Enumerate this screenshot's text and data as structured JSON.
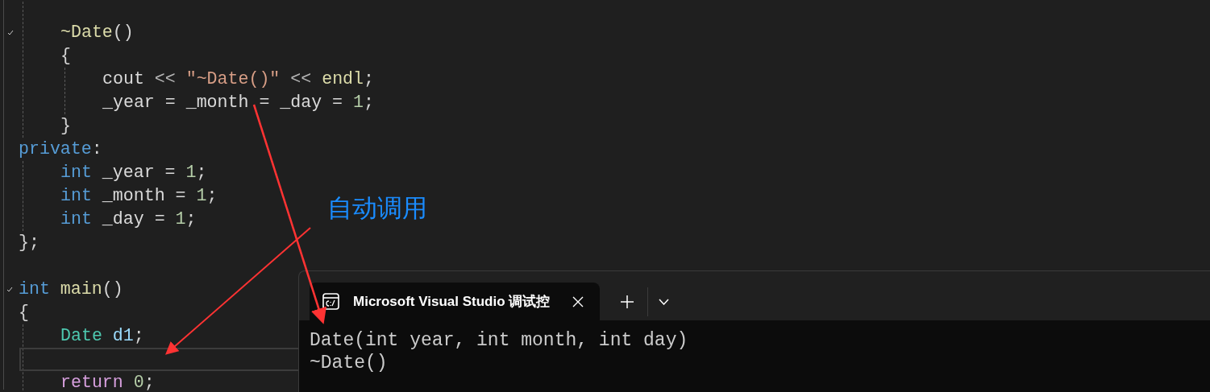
{
  "editor": {
    "lines": [
      {
        "children": [
          {
            "kind": "blank"
          },
          {
            "kind": "code",
            "expanded": true,
            "tokens": [
              {
                "text": "~Date",
                "kind": "function"
              },
              {
                "text": "()",
                "kind": "plain"
              }
            ]
          },
          {
            "kind": "code",
            "tokens": [
              {
                "text": "{",
                "kind": "plain"
              }
            ],
            "children": [
              {
                "kind": "code",
                "tokens": [
                  {
                    "text": "cout",
                    "kind": "variable"
                  },
                  {
                    "text": " << ",
                    "kind": "operator"
                  },
                  {
                    "text": "\"~Date()\"",
                    "kind": "string"
                  },
                  {
                    "text": " << ",
                    "kind": "operator"
                  },
                  {
                    "text": "endl",
                    "kind": "function"
                  },
                  {
                    "text": ";",
                    "kind": "plain"
                  }
                ]
              },
              {
                "kind": "code",
                "tokens": [
                  {
                    "text": "_year = _month = _day = ",
                    "kind": "variable"
                  },
                  {
                    "text": "1",
                    "kind": "number"
                  },
                  {
                    "text": ";",
                    "kind": "plain"
                  }
                ]
              }
            ]
          },
          {
            "kind": "code",
            "tokens": [
              {
                "text": "}",
                "kind": "plain"
              }
            ]
          }
        ]
      },
      {
        "kind": "code",
        "tokens": [
          {
            "text": "private",
            "kind": "keyword"
          },
          {
            "text": ":",
            "kind": "plain"
          }
        ],
        "children": [
          {
            "kind": "code",
            "tokens": [
              {
                "text": "int",
                "kind": "keyword"
              },
              {
                "text": " _year = ",
                "kind": "variable"
              },
              {
                "text": "1",
                "kind": "number"
              },
              {
                "text": ";",
                "kind": "plain"
              }
            ]
          },
          {
            "kind": "code",
            "tokens": [
              {
                "text": "int",
                "kind": "keyword"
              },
              {
                "text": " _month = ",
                "kind": "variable"
              },
              {
                "text": "1",
                "kind": "number"
              },
              {
                "text": ";",
                "kind": "plain"
              }
            ]
          },
          {
            "kind": "code",
            "tokens": [
              {
                "text": "int",
                "kind": "keyword"
              },
              {
                "text": " _day = ",
                "kind": "variable"
              },
              {
                "text": "1",
                "kind": "number"
              },
              {
                "text": ";",
                "kind": "plain"
              }
            ]
          }
        ]
      },
      {
        "kind": "code",
        "tokens": [
          {
            "text": "};",
            "kind": "plain"
          }
        ]
      },
      {
        "kind": "blank"
      },
      {
        "kind": "code",
        "expanded": true,
        "tokens": [
          {
            "text": "int ",
            "kind": "keyword"
          },
          {
            "text": "main",
            "kind": "function"
          },
          {
            "text": "()",
            "kind": "plain"
          }
        ]
      },
      {
        "kind": "code",
        "tokens": [
          {
            "text": "{",
            "kind": "plain"
          }
        ],
        "children": [
          {
            "kind": "code",
            "tokens": [
              {
                "text": "Date ",
                "kind": "type"
              },
              {
                "text": "d1",
                "kind": "local"
              },
              {
                "text": ";",
                "kind": "plain"
              }
            ]
          },
          {
            "kind": "current"
          },
          {
            "kind": "code",
            "tokens": [
              {
                "text": "return ",
                "kind": "control"
              },
              {
                "text": "0",
                "kind": "number"
              },
              {
                "text": ";",
                "kind": "plain"
              }
            ]
          }
        ]
      }
    ]
  },
  "annotation": {
    "label": "自动调用"
  },
  "terminal": {
    "tab": {
      "title": "Microsoft Visual Studio 调试控"
    },
    "output": [
      "Date(int year, int month, int day)",
      "~Date()"
    ]
  }
}
